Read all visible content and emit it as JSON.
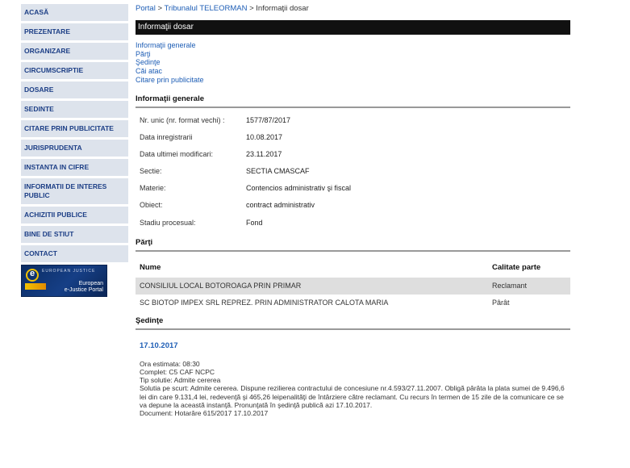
{
  "sidebar": {
    "items": [
      {
        "label": "ACASĂ"
      },
      {
        "label": "PREZENTARE"
      },
      {
        "label": "ORGANIZARE"
      },
      {
        "label": "CIRCUMSCRIPTIE"
      },
      {
        "label": "DOSARE"
      },
      {
        "label": "SEDINTE"
      },
      {
        "label": "CITARE PRIN PUBLICITATE"
      },
      {
        "label": "JURISPRUDENTA"
      },
      {
        "label": "INSTANTA IN CIFRE"
      },
      {
        "label": "INFORMATII DE INTERES PUBLIC"
      },
      {
        "label": "ACHIZITII PUBLICE"
      },
      {
        "label": "BINE DE STIUT"
      },
      {
        "label": "CONTACT"
      }
    ],
    "banner": {
      "top_text": "EUROPEAN JUSTICE",
      "bottom_line1": "European",
      "bottom_line2": "e-Justice Portal"
    }
  },
  "breadcrumb": {
    "portal": "Portal",
    "sep1": " > ",
    "tribunal": "Tribunalul TELEORMAN",
    "sep2": " > ",
    "current": "Informaţii dosar"
  },
  "title": "Informaţii dosar",
  "toc": [
    "Informaţii generale",
    "Părţi",
    "Şedinţe",
    "Căi atac",
    "Citare prin publicitate"
  ],
  "general": {
    "heading": "Informaţii generale",
    "rows": [
      {
        "label": "Nr. unic (nr. format vechi) :",
        "value": "1577/87/2017"
      },
      {
        "label": "Data inregistrarii",
        "value": "10.08.2017"
      },
      {
        "label": "Data ultimei modificari:",
        "value": "23.11.2017"
      },
      {
        "label": "Sectie:",
        "value": "SECTIA CMASCAF"
      },
      {
        "label": "Materie:",
        "value": "Contencios administrativ şi fiscal"
      },
      {
        "label": "Obiect:",
        "value": "contract administrativ"
      },
      {
        "label": "Stadiu procesual:",
        "value": "Fond"
      }
    ]
  },
  "parti": {
    "heading": "Părţi",
    "col_name": "Nume",
    "col_role": "Calitate parte",
    "rows": [
      {
        "name": "CONSILIUL LOCAL BOTOROAGA PRIN PRIMAR",
        "role": "Reclamant"
      },
      {
        "name": "SC BIOTOP IMPEX SRL REPREZ. PRIN ADMINISTRATOR CALOTA MARIA",
        "role": "Pârât"
      }
    ]
  },
  "sedinte": {
    "heading": "Şedinţe",
    "date": "17.10.2017",
    "lines": [
      "Ora estimata: 08:30",
      "Complet: C5 CAF NCPC",
      "Tip solutie: Admite cererea",
      "Solutia pe scurt: Admite cererea. Dispune rezilierea contractului de concesiune nr.4.593/27.11.2007. Obligă pârâta la plata sumei de 9.496,6 lei din care 9.131,4 lei, redevenţă şi 465,26 leipenalităţi de întârziere către reclamant. Cu recurs în termen de 15 zile de la comunicare ce se va depune la această instanţă. Pronunţată în şedinţă publică azi 17.10.2017.",
      "Document: Hotarâre  615/2017  17.10.2017"
    ]
  }
}
